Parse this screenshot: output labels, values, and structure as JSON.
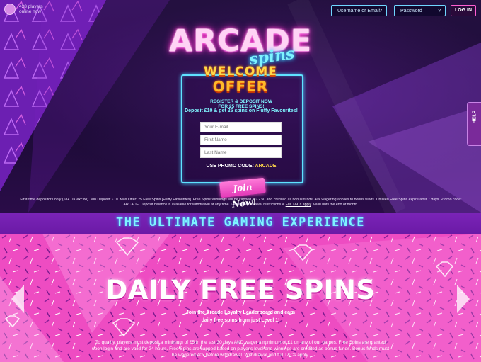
{
  "header": {
    "online_line1": "428 players",
    "online_line2": "online now",
    "username_placeholder": "Username or Email",
    "password_placeholder": "Password",
    "help_icon": "?",
    "login_label": "LOG IN"
  },
  "logo": {
    "title": "ARCADE",
    "subtitle": "spins"
  },
  "offer": {
    "welcome": "WELCOME",
    "offer": "OFFER",
    "line1a": "REGISTER & DEPOSIT NOW",
    "line1b": "FOR 25 FREE SPINS!",
    "line2": "Deposit £10 & get 25 spins on Fluffy Favourites!",
    "email_placeholder": "Your E-mail",
    "first_name_placeholder": "First Name",
    "last_name_placeholder": "Last Name",
    "promo_label": "USE PROMO CODE:",
    "promo_code": "ARCADE",
    "join_label": "Join Now!"
  },
  "terms": {
    "text": "First-time depositors only (18+ UK exc NI). Min Deposit: £10. Max Offer: 25 Free Spins [Fluffy Favourites]. Free Spins Winnings will be capped at £2.50 and credited as bonus funds. 40x wagering applies to bonus funds. Unused Free Spins expire after 7 days. Promo code: ARCADE. Deposit balance is available for withdrawal at any time. General withdrawal restrictions &",
    "link": "Full T&Cs apply",
    "tail": ". Valid until the end of month."
  },
  "help_tab": "HELP",
  "banner": "THE ULTIMATE GAMING EXPERIENCE",
  "slide": {
    "title": "DAILY FREE SPINS",
    "sub_line1": "Join the Arcade Loyalty Leaderboard and earn",
    "sub_line2": "daily free spins from just Level 1!",
    "small_line1": "To qualify, players must deposit a minimum of £5 in the last 30 days AND wager a minimum of £1 on any of our games. Free Spins are granted",
    "small_line2": "upon login and are valid for 24 hours. Free Spins are capped based on player's level and winnings are credited as bonus funds. Bonus funds must",
    "small_line3": "be wagered 40x before withdrawal. Withdrawal and full T&Cs apply."
  },
  "colors": {
    "neon_cyan": "#5fe3ff",
    "neon_pink": "#ff4fd8",
    "purple": "#6b1aa6",
    "pink_bg": "#ef4fc4",
    "gold": "#ffd84a"
  }
}
